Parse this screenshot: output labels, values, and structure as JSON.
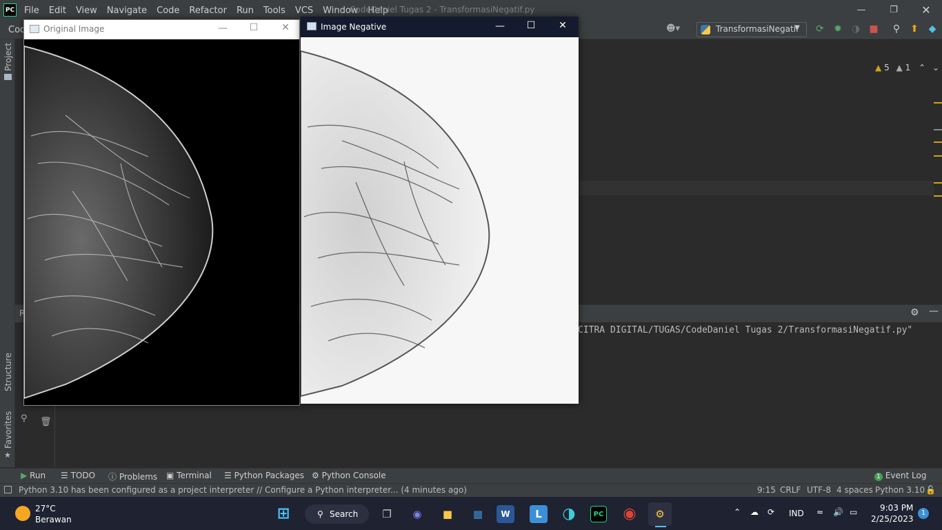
{
  "ide": {
    "logo": "PC",
    "menu": [
      "File",
      "Edit",
      "View",
      "Navigate",
      "Code",
      "Refactor",
      "Run",
      "Tools",
      "VCS",
      "Window",
      "Help"
    ],
    "title": "CodeDaniel Tugas 2 - TransformasiNegatif.py",
    "nav_crumb": "Cod",
    "run_config": "TransformasiNegatif",
    "warnings_count": "5",
    "weak_warnings_count": "1",
    "left_tabs": {
      "project": "Project",
      "structure": "Structure",
      "favorites": "Favorites"
    },
    "run_panel_label": "R",
    "run_command": "CITRA DIGITAL/TUGAS/CodeDaniel Tugas 2/TransformasiNegatif.py\"",
    "tool_windows": [
      "Run",
      "TODO",
      "Problems",
      "Terminal",
      "Python Packages",
      "Python Console"
    ],
    "event_log": "Event Log",
    "event_log_count": "1",
    "status_message": "Python 3.10 has been configured as a project interpreter // Configure a Python interpreter... (4 minutes ago)",
    "status": {
      "position": "9:15",
      "line_sep": "CRLF",
      "encoding": "UTF-8",
      "indent": "4 spaces",
      "interpreter": "Python 3.10"
    }
  },
  "windows": {
    "original": {
      "title": "Original Image"
    },
    "negative": {
      "title": "Image Negative"
    }
  },
  "taskbar": {
    "weather_temp": "27°C",
    "weather_desc": "Berawan",
    "search_label": "Search",
    "language": "IND",
    "time": "9:03 PM",
    "date": "2/25/2023",
    "notification_count": "1"
  },
  "colors": {
    "ide_bg": "#2b2b2b",
    "panel": "#3c3f41",
    "warning": "#d4a017",
    "negative_titlebar": "#151b2e",
    "taskbar": "#1f2230"
  }
}
